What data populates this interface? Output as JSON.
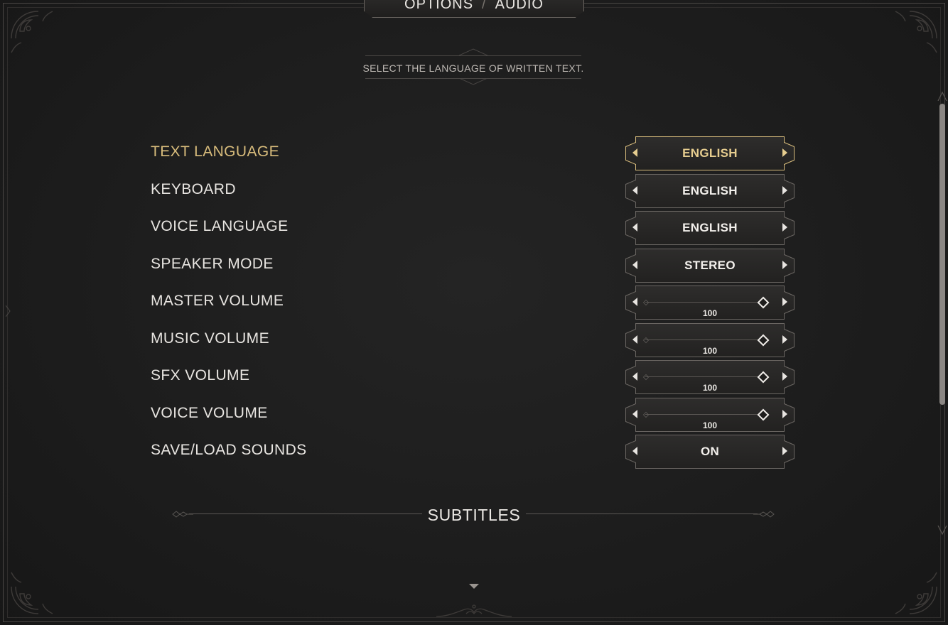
{
  "header": {
    "section": "OPTIONS",
    "separator": "/",
    "tab": "AUDIO"
  },
  "description": "SELECT THE LANGUAGE OF WRITTEN TEXT.",
  "options": [
    {
      "label": "TEXT LANGUAGE",
      "type": "selector",
      "value": "ENGLISH",
      "selected": true
    },
    {
      "label": "KEYBOARD",
      "type": "selector",
      "value": "ENGLISH",
      "selected": false
    },
    {
      "label": "VOICE LANGUAGE",
      "type": "selector",
      "value": "ENGLISH",
      "selected": false
    },
    {
      "label": "SPEAKER MODE",
      "type": "selector",
      "value": "STEREO",
      "selected": false
    },
    {
      "label": "MASTER VOLUME",
      "type": "slider",
      "value": "100",
      "level": 100,
      "selected": false
    },
    {
      "label": "MUSIC VOLUME",
      "type": "slider",
      "value": "100",
      "level": 100,
      "selected": false
    },
    {
      "label": "SFX VOLUME",
      "type": "slider",
      "value": "100",
      "level": 100,
      "selected": false
    },
    {
      "label": "VOICE VOLUME",
      "type": "slider",
      "value": "100",
      "level": 100,
      "selected": false
    },
    {
      "label": "SAVE/LOAD SOUNDS",
      "type": "selector",
      "value": "ON",
      "selected": false
    }
  ],
  "section_heading": "SUBTITLES",
  "colors": {
    "selected_label": "#d8bc7c",
    "selected_value": "#e6cd8f",
    "text": "#e8e5e1",
    "background": "#1d1d1d"
  },
  "icons": {
    "prev": "caret-left-icon",
    "next": "caret-right-icon",
    "scroll": "caret-down-icon"
  }
}
